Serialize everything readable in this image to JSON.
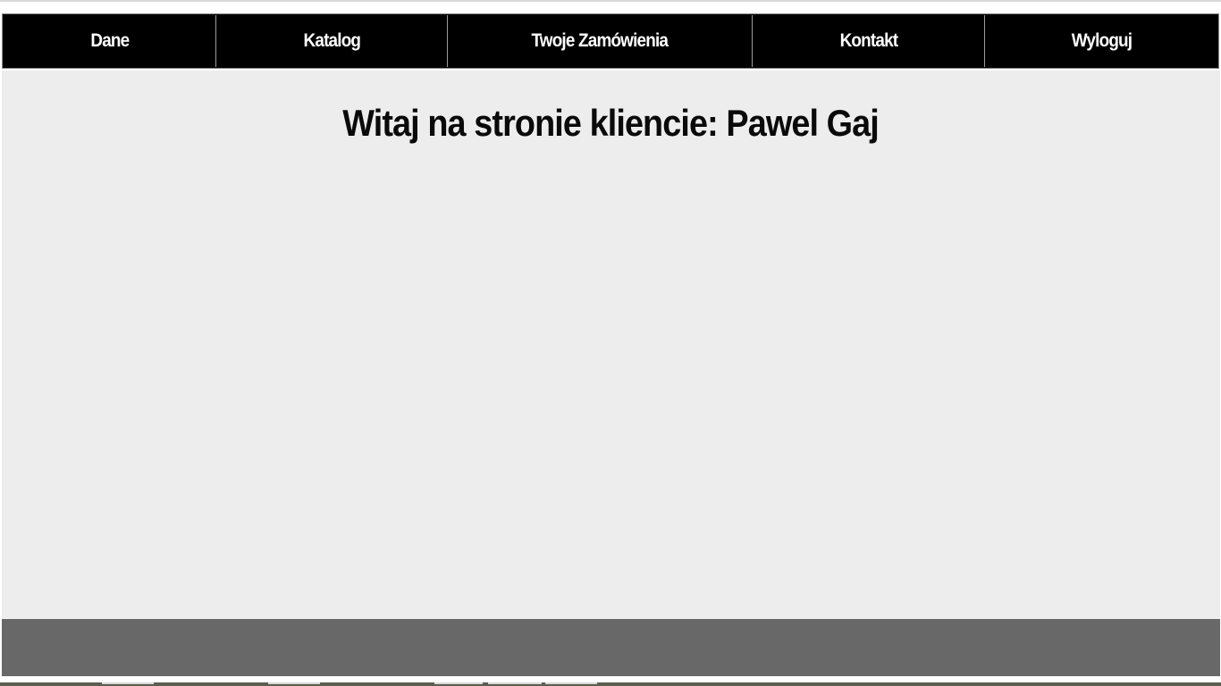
{
  "nav": {
    "items": [
      {
        "label": "Dane"
      },
      {
        "label": "Katalog"
      },
      {
        "label": "Twoje Zamówienia"
      },
      {
        "label": "Kontakt"
      },
      {
        "label": "Wyloguj"
      }
    ]
  },
  "main": {
    "welcome_text": "Witaj na stronie kliencie: Pawel Gaj"
  },
  "colors": {
    "nav_background": "#000000",
    "nav_text": "#ffffff",
    "content_background": "#ededed",
    "footer_background": "#686868"
  }
}
